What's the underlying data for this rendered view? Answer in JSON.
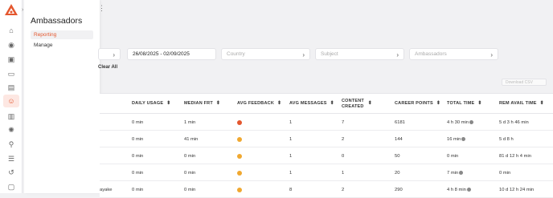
{
  "flyout": {
    "title": "Ambassadors",
    "items": [
      {
        "label": "Reporting",
        "active": true
      },
      {
        "label": "Manage",
        "active": false
      }
    ]
  },
  "rail_icons": [
    "home-icon",
    "globe-icon",
    "inbox-icon",
    "video-icon",
    "document-icon",
    "ambassadors-icon",
    "chart-icon",
    "settings-icon",
    "location-icon",
    "sliders-icon",
    "history-icon",
    "chat-icon"
  ],
  "filters": {
    "date_value": "26/08/2025 - 02/09/2025",
    "country_placeholder": "Country",
    "subject_placeholder": "Subject",
    "ambassadors_placeholder": "Ambassadors"
  },
  "clear_all": "Clear All",
  "download_label": "Download CSV",
  "table": {
    "headers": [
      "Daily Usage",
      "Median FRT",
      "Avg Feedback",
      "Avg Messages",
      "Content Created",
      "Career Points",
      "Total Time",
      "Rem Avail Time"
    ],
    "rows": [
      {
        "name": "",
        "daily": "0 min",
        "frt": "1 min",
        "feedback_color": "#e4572e",
        "msgs": "1",
        "content": "7",
        "points": "6181",
        "total": "4 h 30 min",
        "total_info": true,
        "rem": "5 d 3 h 46 min"
      },
      {
        "name": "",
        "daily": "0 min",
        "frt": "41 min",
        "feedback_color": "#f0a830",
        "msgs": "1",
        "content": "2",
        "points": "144",
        "total": "16 min",
        "total_info": true,
        "rem": "5 d 8 h"
      },
      {
        "name": "",
        "daily": "0 min",
        "frt": "0 min",
        "feedback_color": "#f0a830",
        "msgs": "1",
        "content": "0",
        "points": "50",
        "total": "0 min",
        "total_info": false,
        "rem": "81 d 12 h 4 min"
      },
      {
        "name": "",
        "daily": "0 min",
        "frt": "0 min",
        "feedback_color": "#f0a830",
        "msgs": "1",
        "content": "1",
        "points": "20",
        "total": "7 min",
        "total_info": true,
        "rem": "0 min"
      },
      {
        "name": "ayake",
        "daily": "0 min",
        "frt": "0 min",
        "feedback_color": "#f0a830",
        "msgs": "8",
        "content": "2",
        "points": "290",
        "total": "4 h 8 min",
        "total_info": true,
        "rem": "10 d 12 h 24 min"
      }
    ]
  },
  "colors": {
    "accent": "#e4572e",
    "emoji_neutral": "#f0a830"
  }
}
